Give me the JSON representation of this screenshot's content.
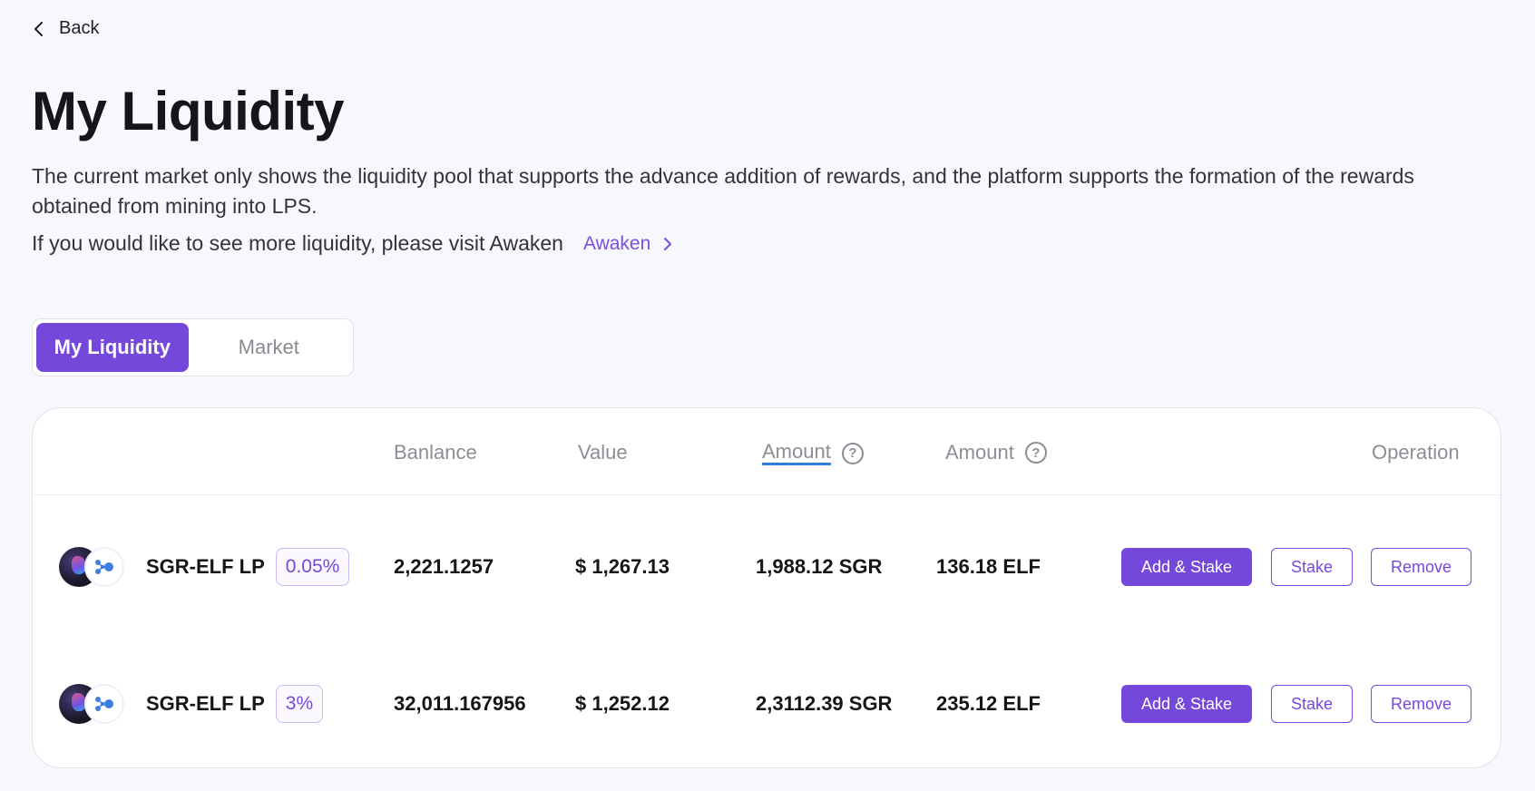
{
  "nav": {
    "back_label": "Back"
  },
  "page": {
    "title": "My Liquidity",
    "description": "The current market only shows the liquidity pool that supports the advance addition of rewards, and the platform supports the formation of the rewards obtained from mining into LPS.",
    "visit_text": "If you would like to see more liquidity, please visit Awaken",
    "visit_link_label": "Awaken"
  },
  "tabs": [
    {
      "label": "My Liquidity",
      "active": true
    },
    {
      "label": "Market",
      "active": false
    }
  ],
  "table": {
    "columns": {
      "balance": "Banlance",
      "value": "Value",
      "amount_a": "Amount",
      "amount_b": "Amount",
      "operation": "Operation"
    },
    "rows": [
      {
        "pair": "SGR-ELF LP",
        "fee": "0.05%",
        "balance": "2,221.1257",
        "value": "$ 1,267.13",
        "amount_a": "1,988.12 SGR",
        "amount_b": "136.18 ELF",
        "actions": {
          "add_stake": "Add & Stake",
          "stake": "Stake",
          "remove": "Remove"
        }
      },
      {
        "pair": "SGR-ELF LP",
        "fee": "3%",
        "balance": "32,011.167956",
        "value": "$ 1,252.12",
        "amount_a": "2,3112.39 SGR",
        "amount_b": "235.12 ELF",
        "actions": {
          "add_stake": "Add & Stake",
          "stake": "Stake",
          "remove": "Remove"
        }
      }
    ]
  },
  "colors": {
    "accent": "#7548dc",
    "link": "#7b4fe0",
    "underline": "#2f7fe0",
    "muted": "#8d8d95"
  },
  "icons": {
    "back": "chevron-left-icon",
    "link": "chevron-right-icon",
    "help": "question-circle-icon",
    "token_a": "sgr-token-icon",
    "token_b": "elf-token-icon"
  }
}
